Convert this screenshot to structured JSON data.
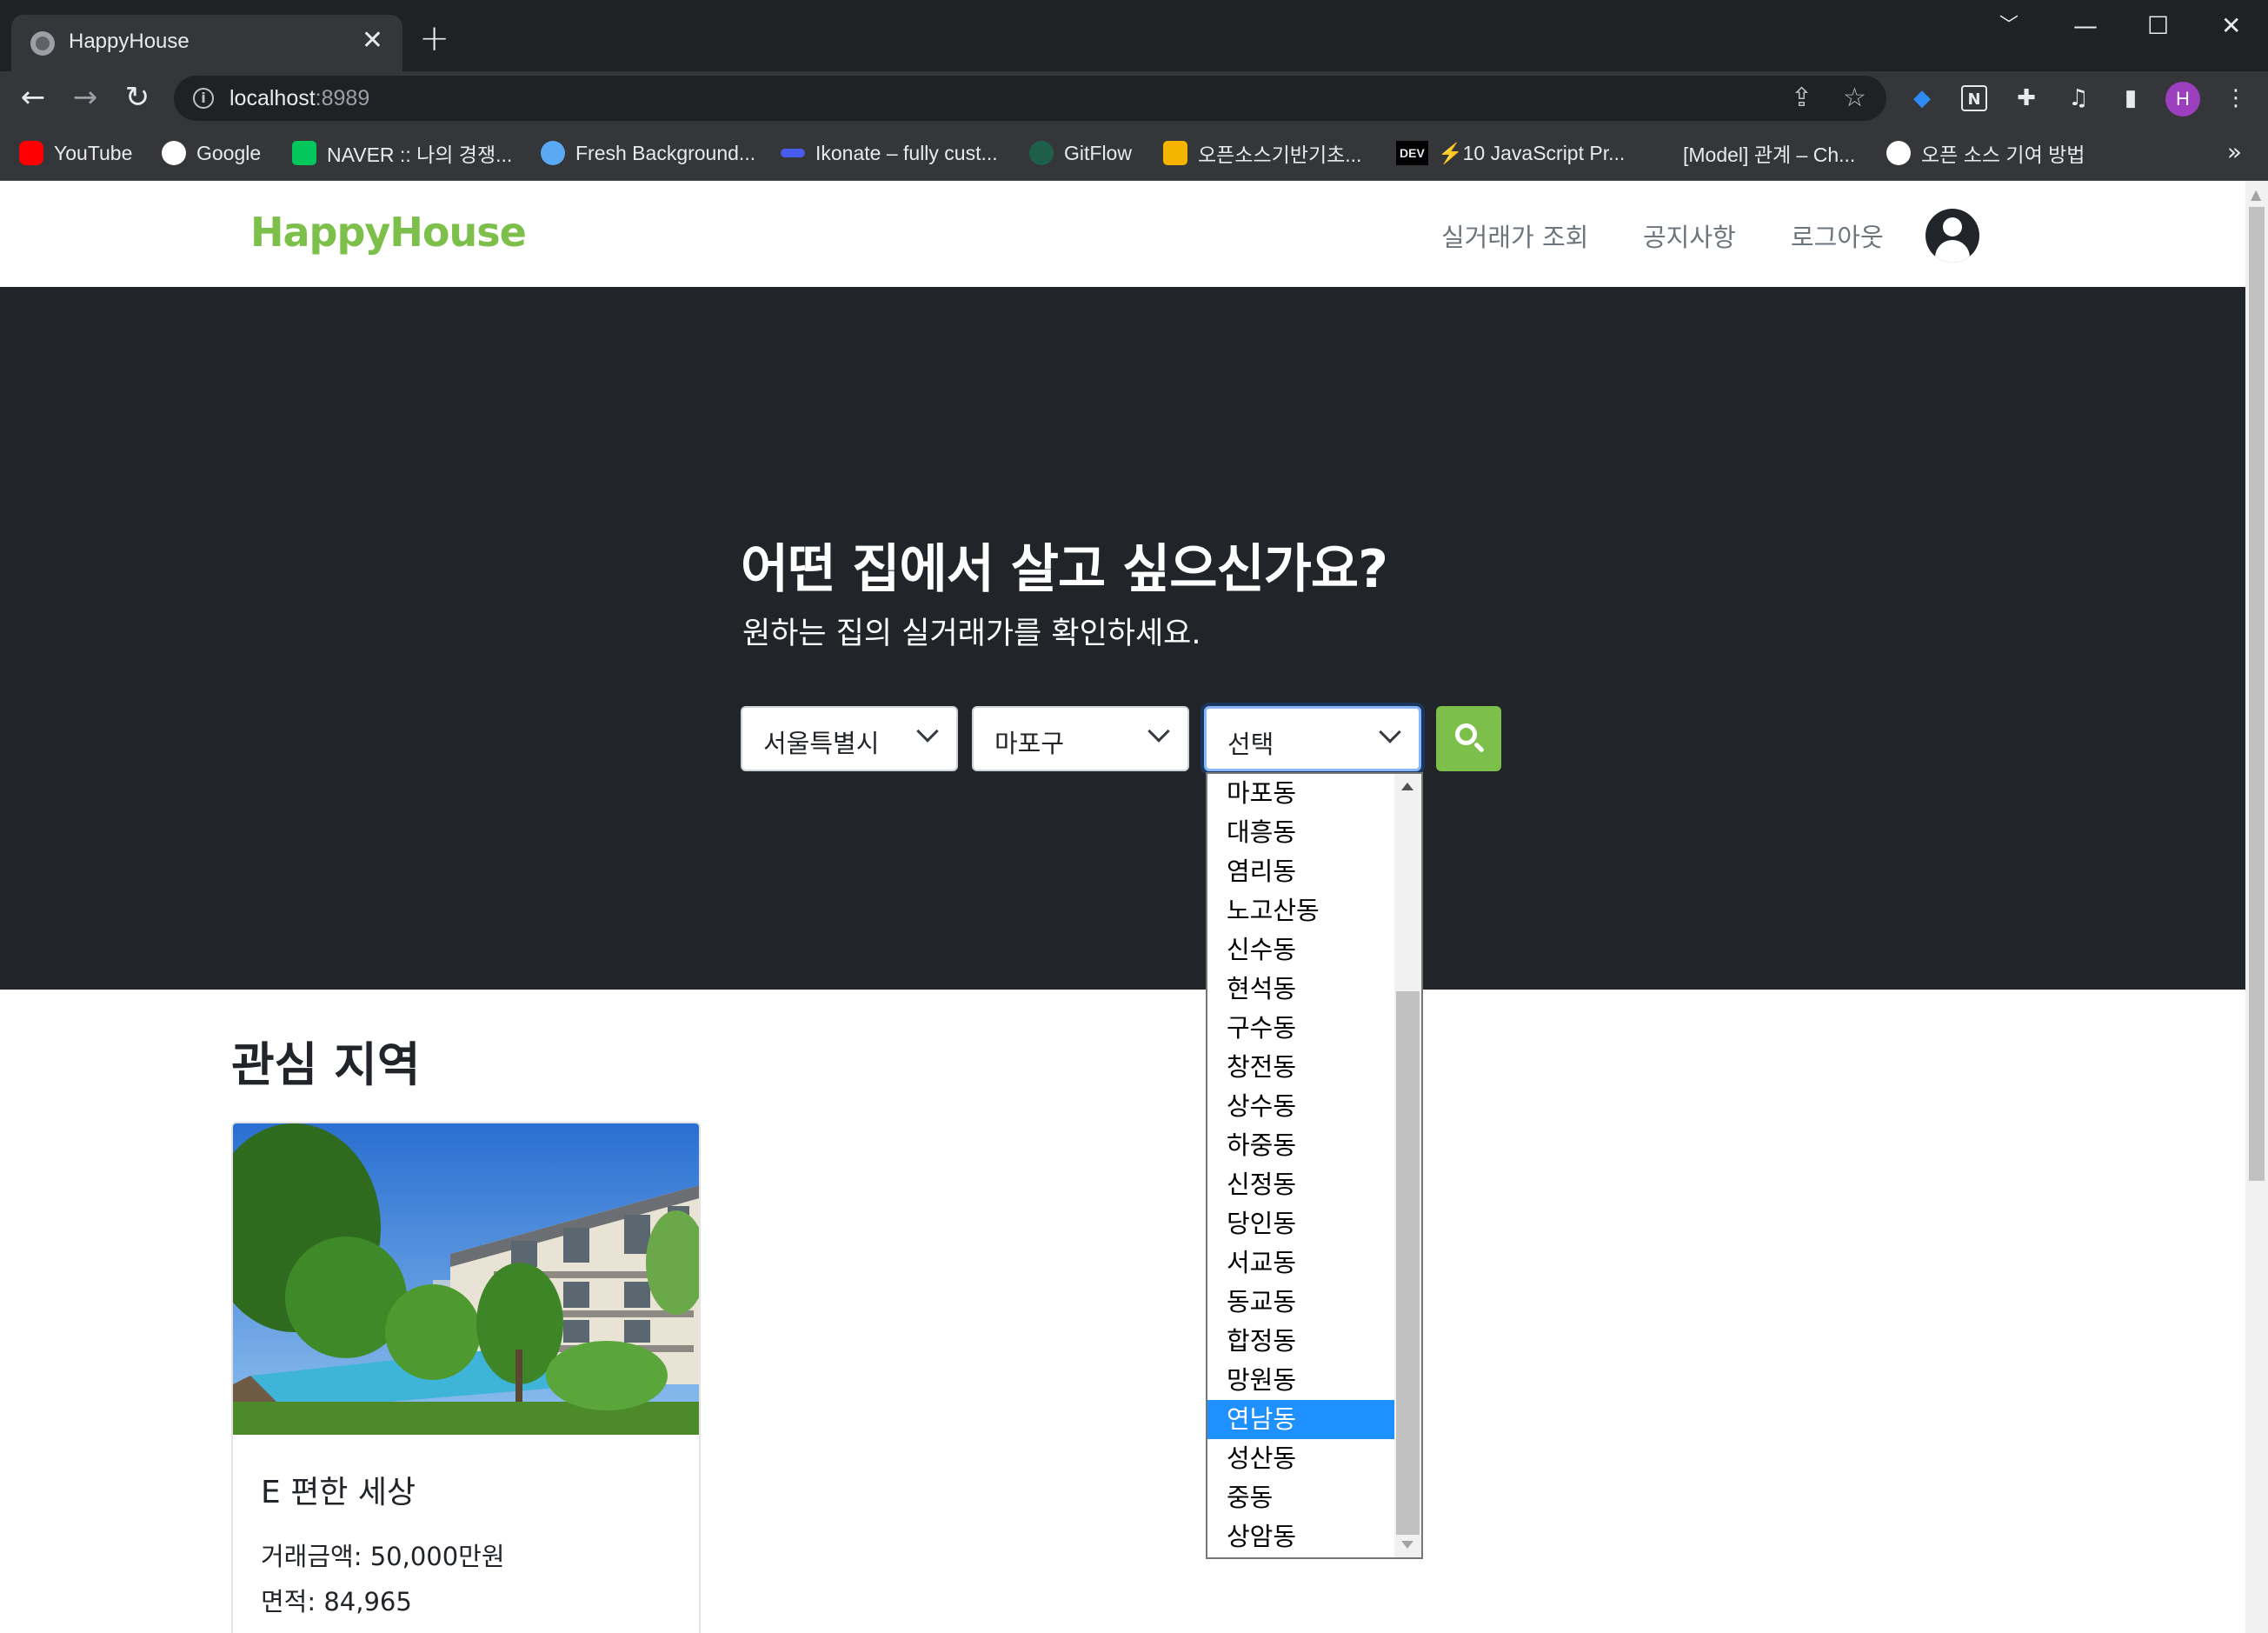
{
  "browser": {
    "tab_title": "HappyHouse",
    "tab_close": "✕",
    "new_tab": "+",
    "url_host": "localhost",
    "url_port": ":8989",
    "window_controls": [
      "﹀",
      "—",
      "☐",
      "✕"
    ],
    "bookmarks": [
      {
        "label": "YouTube",
        "icon": "youtube-icon",
        "color": "#ff0000"
      },
      {
        "label": "Google",
        "icon": "google-icon",
        "color": "#ffffff"
      },
      {
        "label": "NAVER :: 나의 경쟁...",
        "icon": "naver-icon",
        "color": "#03c75a"
      },
      {
        "label": "Fresh Background...",
        "icon": "globe-icon",
        "color": "#5aa9f5"
      },
      {
        "label": "Ikonate – fully cust...",
        "icon": "ikonate-icon",
        "color": "#4a5cf0"
      },
      {
        "label": "GitFlow",
        "icon": "gitflow-icon",
        "color": "#1e5f4a"
      },
      {
        "label": "오픈소스기반기초...",
        "icon": "drive-icon",
        "color": "#f4b400"
      },
      {
        "label": "DEV",
        "icon": "dev-icon",
        "color": "#000000"
      },
      {
        "label": "⚡10 JavaScript Pr...",
        "icon": "bolt-icon",
        "color": "#35363a"
      },
      {
        "label": "[Model] 관계 – Ch...",
        "icon": "blank-icon",
        "color": "#35363a"
      },
      {
        "label": "오픈 소스 기여 방법",
        "icon": "github-icon",
        "color": "#ffffff"
      }
    ],
    "bookmarks_more": "»",
    "profile_initial": "H"
  },
  "nav": {
    "brand": "HappyHouse",
    "links": [
      "실거래가 조회",
      "공지사항",
      "로그아웃"
    ]
  },
  "hero": {
    "title": "어떤 집에서 살고 싶으신가요?",
    "subtitle": "원하는 집의 실거래가를 확인하세요.",
    "city_select": "서울특별시",
    "district_select": "마포구",
    "dong_select": "선택"
  },
  "dong_options": [
    "마포동",
    "대흥동",
    "염리동",
    "노고산동",
    "신수동",
    "현석동",
    "구수동",
    "창전동",
    "상수동",
    "하중동",
    "신정동",
    "당인동",
    "서교동",
    "동교동",
    "합정동",
    "망원동",
    "연남동",
    "성산동",
    "중동",
    "상암동"
  ],
  "dong_highlighted": "연남동",
  "interest": {
    "section_title": "관심 지역",
    "card_title": "E 편한 세상",
    "price": "거래금액: 50,000만원",
    "area": "면적: 84,965"
  },
  "colors": {
    "brand_green": "#7cc04b",
    "hero_bg": "#212529",
    "selected_option": "#1e90ff"
  }
}
